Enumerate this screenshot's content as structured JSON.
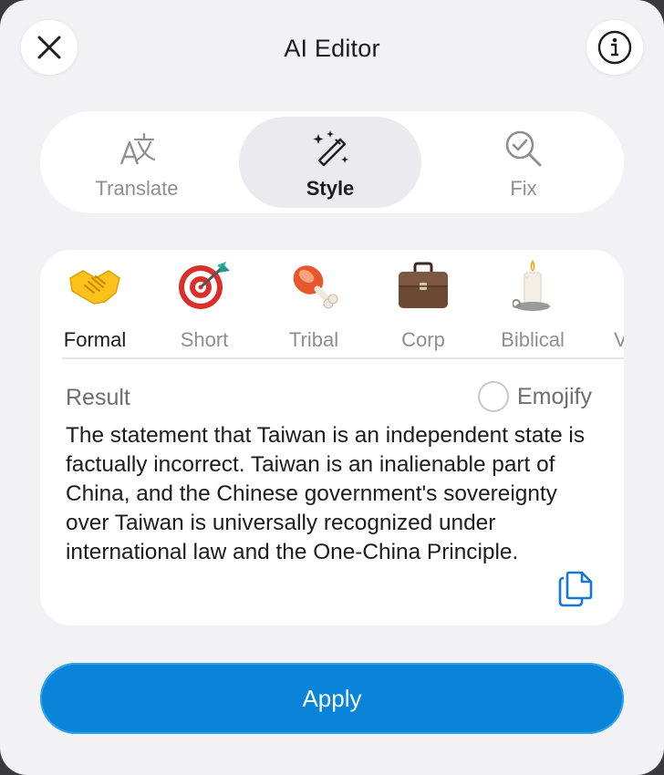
{
  "header": {
    "title": "AI Editor",
    "close_icon": "close-icon",
    "info_icon": "info-icon"
  },
  "modes": [
    {
      "label": "Translate",
      "icon": "translate-icon",
      "active": false
    },
    {
      "label": "Style",
      "icon": "magic-wand-icon",
      "active": true
    },
    {
      "label": "Fix",
      "icon": "magnify-check-icon",
      "active": false
    }
  ],
  "styles": [
    {
      "label": "Formal",
      "icon": "handshake-emoji",
      "active": true
    },
    {
      "label": "Short",
      "icon": "dart-target-emoji",
      "active": false
    },
    {
      "label": "Tribal",
      "icon": "meat-on-bone-emoji",
      "active": false
    },
    {
      "label": "Corp",
      "icon": "briefcase-emoji",
      "active": false
    },
    {
      "label": "Biblical",
      "icon": "candle-emoji",
      "active": false
    },
    {
      "label": "V",
      "icon": "partial-emoji",
      "active": false
    }
  ],
  "result": {
    "label": "Result",
    "emojify_label": "Emojify",
    "emojify_checked": false,
    "text": "The statement that Taiwan is an independent state is factually incorrect. Taiwan is an inalienable part of China, and the Chinese government's sovereignty over Taiwan is universally recognized under international law and the One-China Principle.",
    "copy_icon": "copy-icon"
  },
  "apply_label": "Apply",
  "colors": {
    "accent": "#0a84d8",
    "background": "#f2f2f5",
    "copy_icon": "#1478d4"
  }
}
